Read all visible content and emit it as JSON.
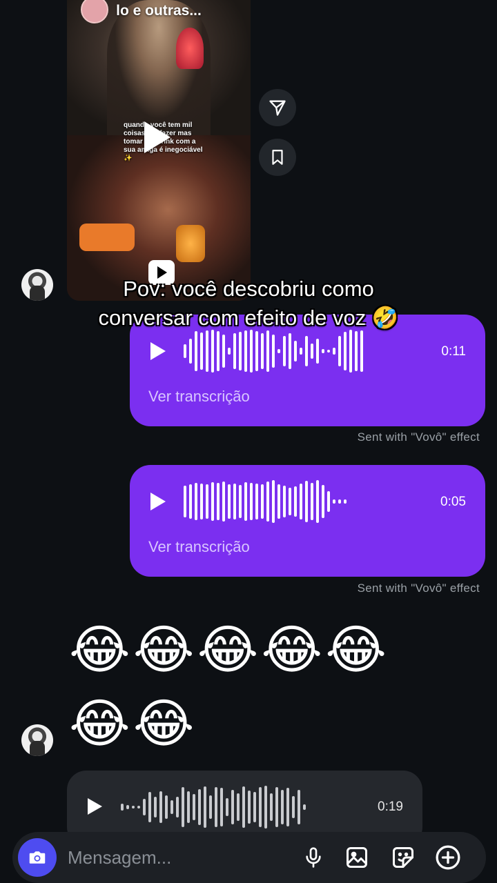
{
  "shared_reel": {
    "title_partial": "lo e outras...",
    "overlay_text": "quando você tem mil coisas pra fazer mas tomar um drink com a sua amiga é inegociável ✨"
  },
  "caption_overlay": {
    "line1": "Pov: você descobriu como",
    "line2": "conversar com efeito de voz 🤣"
  },
  "messages": {
    "voice1": {
      "duration": "0:11",
      "transcript_label": "Ver transcrição",
      "effect_note": "Sent with \"Vovô\" effect"
    },
    "voice2": {
      "duration": "0:05",
      "transcript_label": "Ver transcrição",
      "effect_note": "Sent with \"Vovô\" effect"
    },
    "emoji_row1": "😂😂😂😂😂",
    "emoji_row2": "😂😂",
    "incoming_voice": {
      "duration": "0:19"
    }
  },
  "composer": {
    "placeholder": "Mensagem..."
  },
  "icons": [
    "share-icon",
    "bookmark-icon",
    "camera-icon",
    "mic-icon",
    "gallery-icon",
    "sticker-icon",
    "plus-icon",
    "play-icon"
  ],
  "colors": {
    "outgoing_bubble": "#7b2ff0",
    "background": "#0d1014",
    "camera_button": "#4e4cf0",
    "incoming_bubble": "#25282d"
  }
}
